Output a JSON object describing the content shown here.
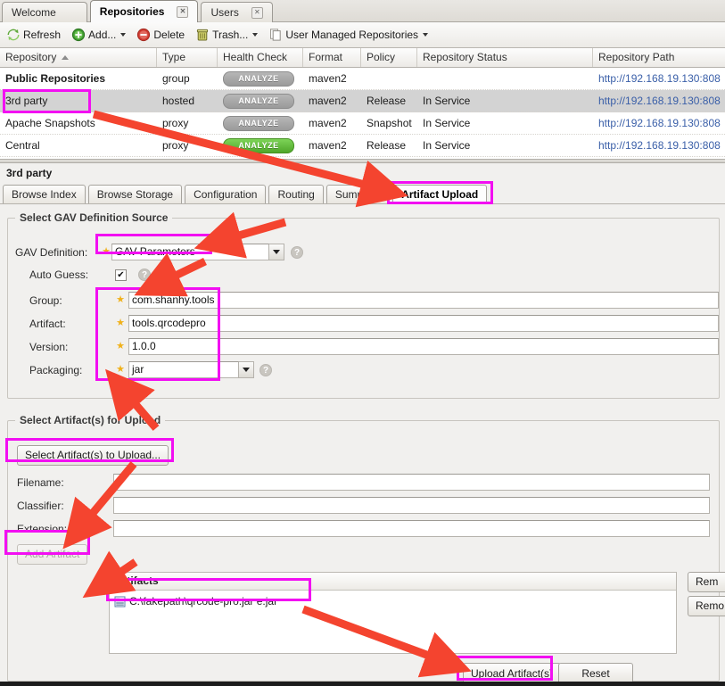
{
  "window": {
    "tabs": [
      {
        "label": "Welcome",
        "closable": false,
        "active": false
      },
      {
        "label": "Repositories",
        "closable": true,
        "active": true
      },
      {
        "label": "Users",
        "closable": true,
        "active": false
      }
    ]
  },
  "toolbar": {
    "refresh": "Refresh",
    "add": "Add...",
    "delete": "Delete",
    "trash": "Trash...",
    "user_managed": "User Managed Repositories"
  },
  "grid": {
    "columns": [
      "Repository",
      "Type",
      "Health Check",
      "Format",
      "Policy",
      "Repository Status",
      "Repository Path"
    ],
    "sorted_column": "Repository",
    "sort_direction": "asc",
    "rows": [
      {
        "repository": "Public Repositories",
        "type": "group",
        "health": "ANALYZE",
        "health_state": "grey",
        "format": "maven2",
        "policy": "",
        "status": "",
        "path": "http://192.168.19.130:808",
        "selected": false
      },
      {
        "repository": "3rd party",
        "type": "hosted",
        "health": "ANALYZE",
        "health_state": "grey",
        "format": "maven2",
        "policy": "Release",
        "status": "In Service",
        "path": "http://192.168.19.130:808",
        "selected": true
      },
      {
        "repository": "Apache Snapshots",
        "type": "proxy",
        "health": "ANALYZE",
        "health_state": "grey",
        "format": "maven2",
        "policy": "Snapshot",
        "status": "In Service",
        "path": "http://192.168.19.130:808",
        "selected": false
      },
      {
        "repository": "Central",
        "type": "proxy",
        "health": "ANALYZE",
        "health_state": "green",
        "format": "maven2",
        "policy": "Release",
        "status": "In Service",
        "path": "http://192.168.19.130:808",
        "selected": false
      }
    ]
  },
  "detail": {
    "title": "3rd party",
    "tabs": [
      {
        "label": "Browse Index",
        "active": false
      },
      {
        "label": "Browse Storage",
        "active": false
      },
      {
        "label": "Configuration",
        "active": false
      },
      {
        "label": "Routing",
        "active": false
      },
      {
        "label": "Summary",
        "active": false
      },
      {
        "label": "Artifact Upload",
        "active": true
      }
    ]
  },
  "gav_group": {
    "legend": "Select GAV Definition Source",
    "gav_definition_label": "GAV Definition:",
    "gav_definition_value": "GAV Parameters",
    "auto_guess_label": "Auto Guess:",
    "auto_guess_checked": true,
    "auto_guess_mark": "✔",
    "group_label": "Group:",
    "group_value": "com.shanhy.tools",
    "artifact_label": "Artifact:",
    "artifact_value": "tools.qrcodepro",
    "version_label": "Version:",
    "version_value": "1.0.0",
    "packaging_label": "Packaging:",
    "packaging_value": "jar",
    "help_glyph": "?",
    "required_star": "★"
  },
  "upload_group": {
    "legend": "Select Artifact(s) for Upload",
    "select_button": "Select Artifact(s) to Upload...",
    "filename_label": "Filename:",
    "filename_value": "",
    "classifier_label": "Classifier:",
    "classifier_value": "",
    "extension_label": "Extension:",
    "extension_value": "",
    "add_artifact_button": "Add Artifact",
    "add_artifact_disabled": true,
    "artifacts_header": "Artifacts",
    "artifacts": [
      {
        "name": "C:\\fakepath\\qrcode-pro.jar e:jar"
      }
    ],
    "remove_button": "Rem",
    "remove_all_button": "Remo",
    "upload_button": "Upload Artifact(s)",
    "reset_button": "Reset"
  },
  "annotations": {
    "highlight_color": "#f20ff2",
    "arrow_color": "#f4442f",
    "highlighted_items": [
      "3rd party repository row",
      "Artifact Upload tab",
      "GAV Definition combo",
      "GAV parameter fields",
      "Select Artifact(s) to Upload button",
      "Add Artifact button",
      "artifact list entry",
      "Upload Artifact(s) button"
    ]
  }
}
